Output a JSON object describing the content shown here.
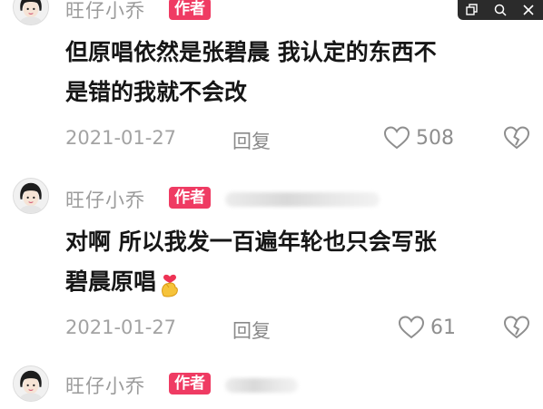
{
  "top_controls": {
    "icons": [
      "copy-icon",
      "search-icon",
      "close-icon"
    ]
  },
  "comments": [
    {
      "username": "旺仔小乔",
      "badge": "作者",
      "text_lines": [
        "但原唱依然是张碧晨 我认定的东西不",
        "是错的我就不会改"
      ],
      "date": "2021-01-27",
      "reply_label": "回复",
      "likes": "508"
    },
    {
      "username": "旺仔小乔",
      "badge": "作者",
      "text_lines": [
        "对啊 所以我发一百遍年轮也只会写张",
        "碧晨原唱"
      ],
      "emoji": "finger-heart-emoji",
      "date": "2021-01-27",
      "reply_label": "回复",
      "likes": "61"
    },
    {
      "username": "旺仔小乔",
      "badge": "作者"
    }
  ],
  "colors": {
    "badge": "#ef3b63",
    "username": "#9b9b9b",
    "text": "#161616",
    "meta": "#a3a3a3"
  }
}
